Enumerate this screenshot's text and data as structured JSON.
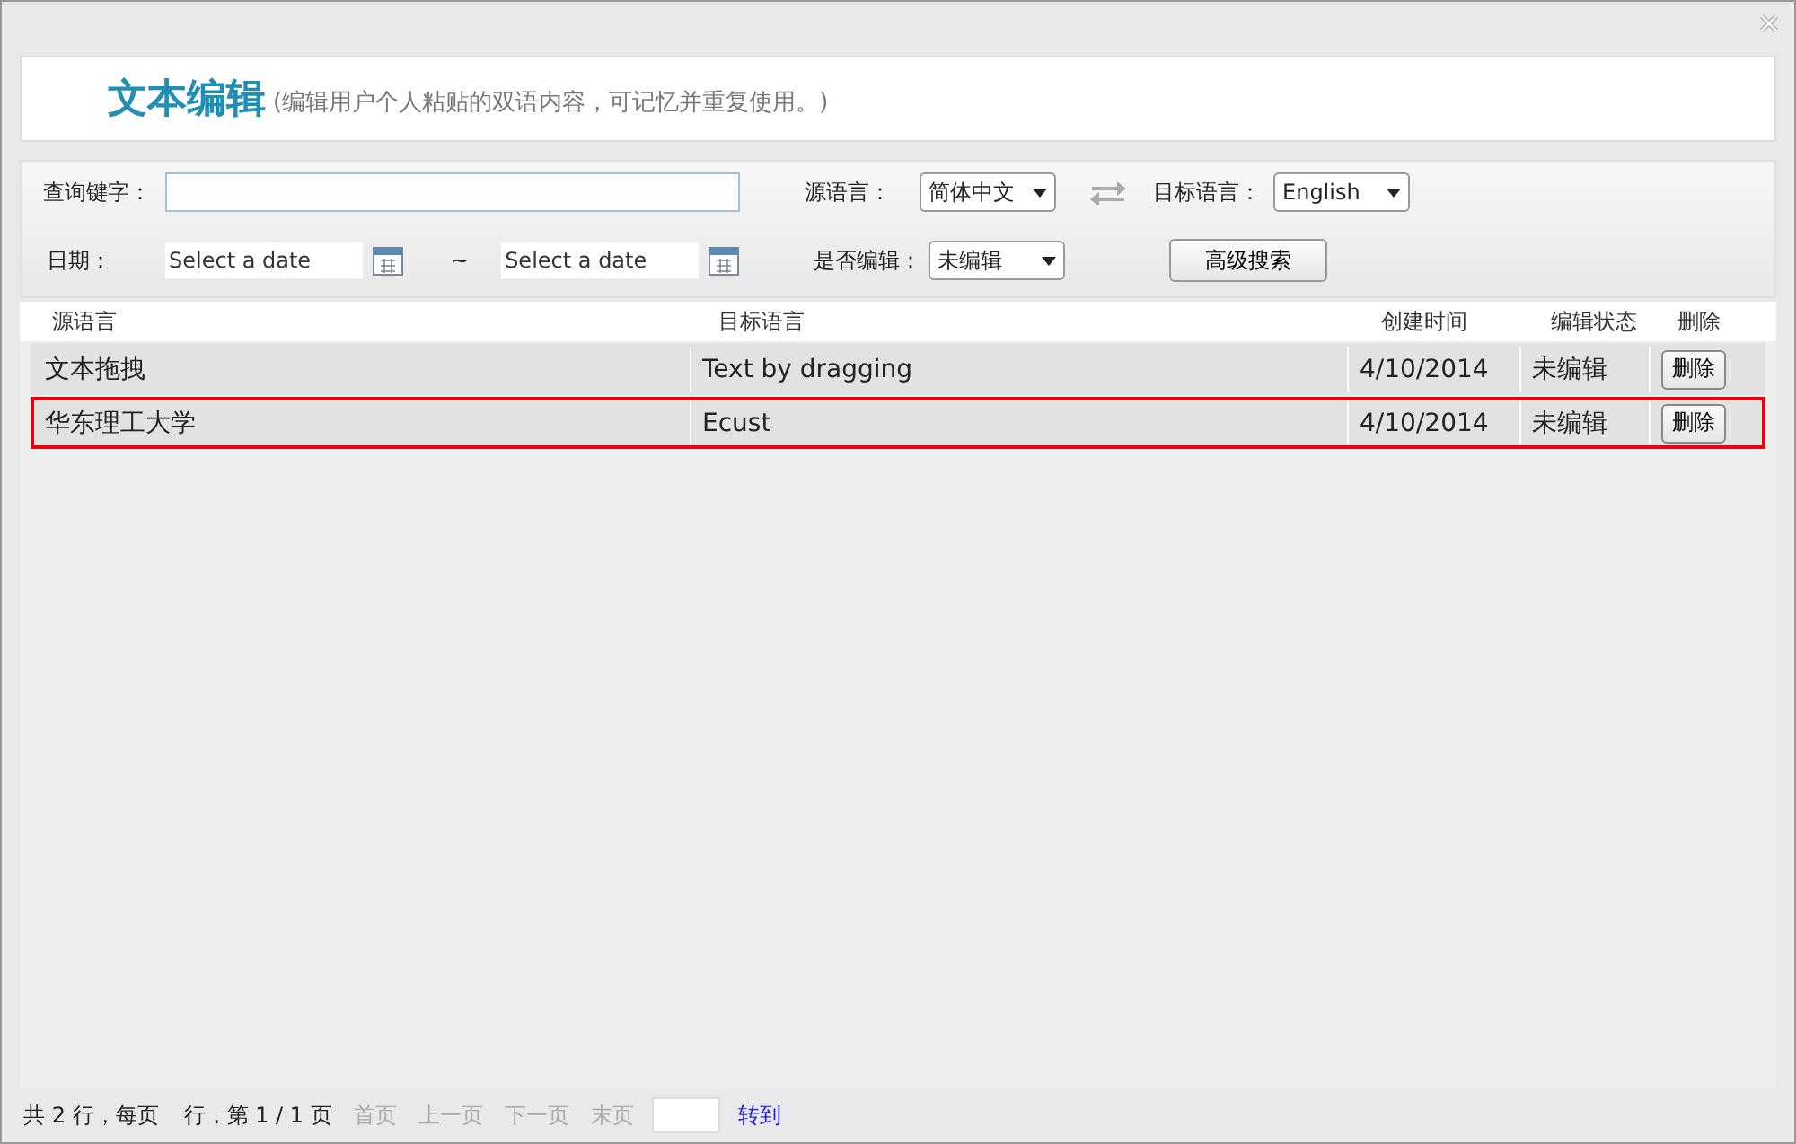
{
  "header": {
    "title": "文本编辑",
    "subtitle": "(编辑用户个人粘贴的双语内容，可记忆并重复使用。)"
  },
  "search": {
    "keyword_label": "查询键字：",
    "source_label": "源语言：",
    "source_value": "简体中文",
    "target_label": "目标语言：",
    "target_value": "English",
    "date_label": "日期：",
    "date_from_placeholder": "Select a date",
    "range_sep": "~",
    "date_to_placeholder": "Select a date",
    "edited_label": "是否编辑：",
    "edited_value": "未编辑",
    "advanced_button": "高级搜索"
  },
  "table": {
    "columns": [
      "源语言",
      "目标语言",
      "创建时间",
      "编辑状态",
      "删除"
    ],
    "rows": [
      {
        "source": "文本拖拽",
        "target": "Text by dragging",
        "created": "4/10/2014",
        "status": "未编辑",
        "action": "删除",
        "highlighted": false
      },
      {
        "source": "华东理工大学",
        "target": "Ecust",
        "created": "4/10/2014",
        "status": "未编辑",
        "action": "删除",
        "highlighted": true
      }
    ]
  },
  "pager": {
    "summary_left": "共 2 行，每页",
    "summary_right": "行，第 1 / 1 页",
    "links": [
      {
        "label": "首页",
        "disabled": true
      },
      {
        "label": "上一页",
        "disabled": true
      },
      {
        "label": "下一页",
        "disabled": true
      },
      {
        "label": "末页",
        "disabled": true
      }
    ],
    "go": "转到"
  }
}
